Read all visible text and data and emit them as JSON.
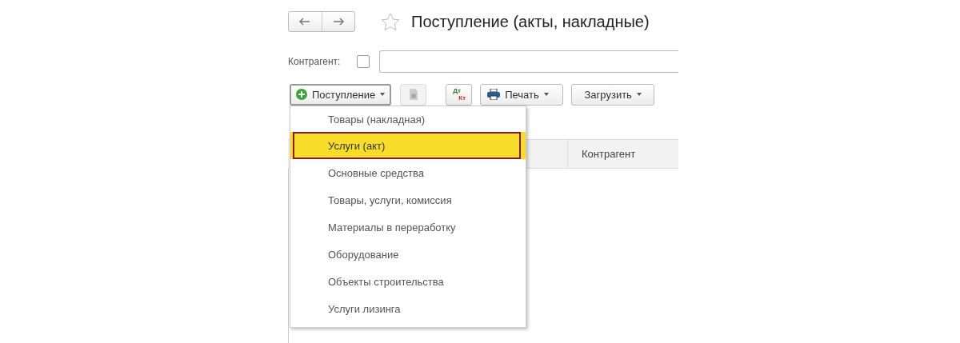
{
  "window": {
    "title": "Поступление (акты, накладные)",
    "favorite": false
  },
  "filter": {
    "label": "Контрагент:",
    "checked": false
  },
  "toolbar": {
    "create_button": "Поступление",
    "dt_kt_button": {
      "top": "Дт",
      "bottom": "Кт"
    },
    "print_button": "Печать",
    "load_button": "Загрузить"
  },
  "table": {
    "columns": [
      "Контрагент"
    ]
  },
  "dropdown_menu": {
    "items": [
      {
        "label": "Товары (накладная)",
        "selected": false,
        "outlined": false
      },
      {
        "label": "Услуги (акт)",
        "selected": true,
        "outlined": true
      },
      {
        "label": "Основные средства",
        "selected": false,
        "outlined": false
      },
      {
        "label": "Товары, услуги, комиссия",
        "selected": false,
        "outlined": false
      },
      {
        "label": "Материалы в переработку",
        "selected": false,
        "outlined": false
      },
      {
        "label": "Оборудование",
        "selected": false,
        "outlined": false
      },
      {
        "label": "Объекты строительства",
        "selected": false,
        "outlined": false
      },
      {
        "label": "Услуги лизинга",
        "selected": false,
        "outlined": false
      }
    ]
  }
}
